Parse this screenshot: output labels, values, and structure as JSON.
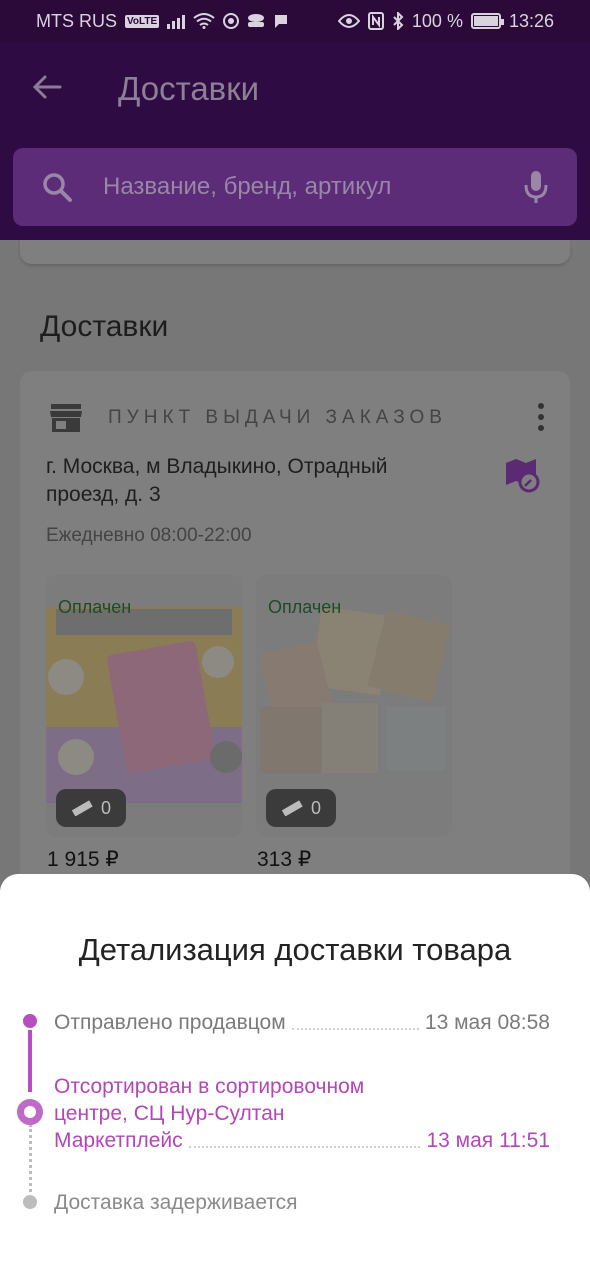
{
  "status_bar": {
    "carrier": "MTS RUS",
    "volte": "VoLTE",
    "battery": "100 %",
    "time": "13:26"
  },
  "header": {
    "title": "Доставки",
    "search_placeholder": "Название, бренд, артикул"
  },
  "main": {
    "section_title": "Доставки",
    "card": {
      "type_label": "ПУНКТ ВЫДАЧИ ЗАКАЗОВ",
      "address": "г. Москва, м Владыкино, Отрадный проезд, д. 3",
      "hours": "Ежедневно 08:00-22:00",
      "items": [
        {
          "status": "Оплачен",
          "rating_count": "0",
          "price": "1 915 ₽"
        },
        {
          "status": "Оплачен",
          "rating_count": "0",
          "price": "313 ₽"
        }
      ]
    }
  },
  "sheet": {
    "title": "Детализация доставки товара",
    "events": [
      {
        "name": "Отправлено продавцом",
        "time": "13 мая 08:58"
      },
      {
        "line1": "Отсортирован в сортировочном",
        "line2": "центре, СЦ Нур-Султан",
        "line3": "Маркетплейс",
        "time": "13 мая 11:51"
      },
      {
        "name": "Доставка задерживается"
      }
    ]
  },
  "colors": {
    "brand": "#2f0b44",
    "accent": "#b346b8",
    "paid": "#1f4a26"
  }
}
